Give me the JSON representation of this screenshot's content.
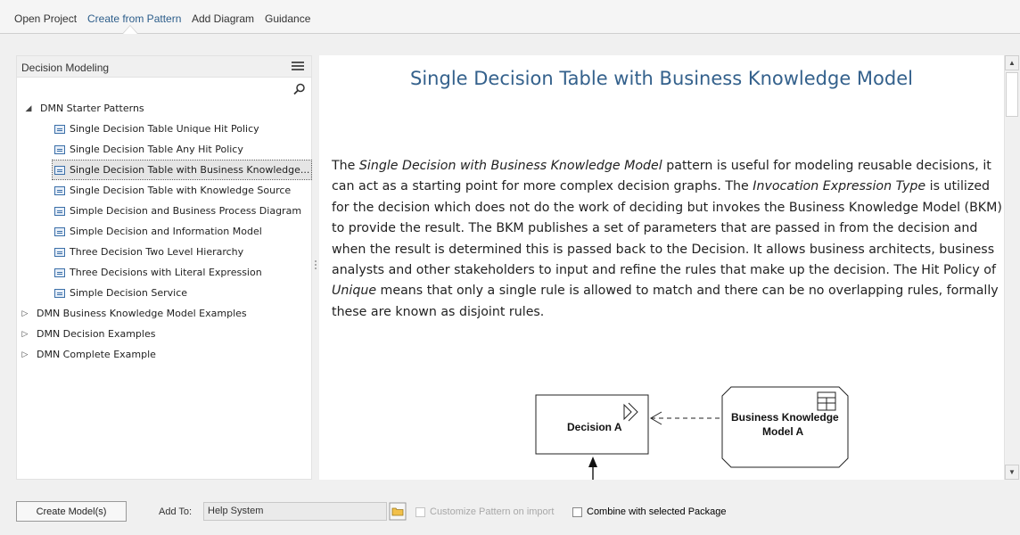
{
  "tabs": [
    {
      "label": "Open Project"
    },
    {
      "label": "Create from Pattern"
    },
    {
      "label": "Add Diagram"
    },
    {
      "label": "Guidance"
    }
  ],
  "left_panel": {
    "title": "Decision Modeling",
    "tree": [
      {
        "label": "DMN Starter Patterns",
        "expanded": true
      },
      {
        "label": "Single Decision Table Unique Hit Policy"
      },
      {
        "label": "Single Decision Table Any Hit Policy"
      },
      {
        "label": "Single Decision Table with Business Knowledge...",
        "selected": true
      },
      {
        "label": "Single Decision Table with Knowledge Source"
      },
      {
        "label": "Simple Decision and Business Process Diagram"
      },
      {
        "label": "Simple Decision and Information Model"
      },
      {
        "label": "Three Decision Two Level Hierarchy"
      },
      {
        "label": "Three Decisions with Literal Expression"
      },
      {
        "label": "Simple Decision Service"
      },
      {
        "label": "DMN Business Knowledge Model Examples",
        "expanded": false
      },
      {
        "label": "DMN Decision Examples",
        "expanded": false
      },
      {
        "label": "DMN Complete Example",
        "expanded": false
      }
    ]
  },
  "document": {
    "title": "Single Decision Table with Business Knowledge Model",
    "p1": "The ",
    "p1_em": "Single Decision with Business Knowledge Model",
    "p2": " pattern is useful for modeling reusable decisions, it can act as a starting point for more complex decision graphs. The ",
    "p2_em": "Invocation Expression Type",
    "p3": " is utilized for the decision which does not do the work of deciding but invokes the Business Knowledge Model (BKM) to provide the result. The BKM publishes a set of parameters that are passed in from the decision and when the result is determined this is passed back to the Decision. It allows business architects, business analysts and other stakeholders to input and refine the rules that make up the decision. The Hit Policy of ",
    "p3_em": "Unique",
    "p4": " means that only a single rule is allowed to match and there can be no overlapping rules, formally these are known as disjoint rules.",
    "diagram": {
      "decision_label": "Decision A",
      "bkm_label_1": "Business Knowledge",
      "bkm_label_2": "Model A"
    }
  },
  "bottom": {
    "create_button": "Create Model(s)",
    "add_to_label": "Add To:",
    "add_to_value": "Help System",
    "customize_label": "Customize Pattern on import",
    "combine_label": "Combine with selected Package"
  },
  "colors": {
    "title": "#34618c",
    "active_tab": "#2c5d8a"
  }
}
